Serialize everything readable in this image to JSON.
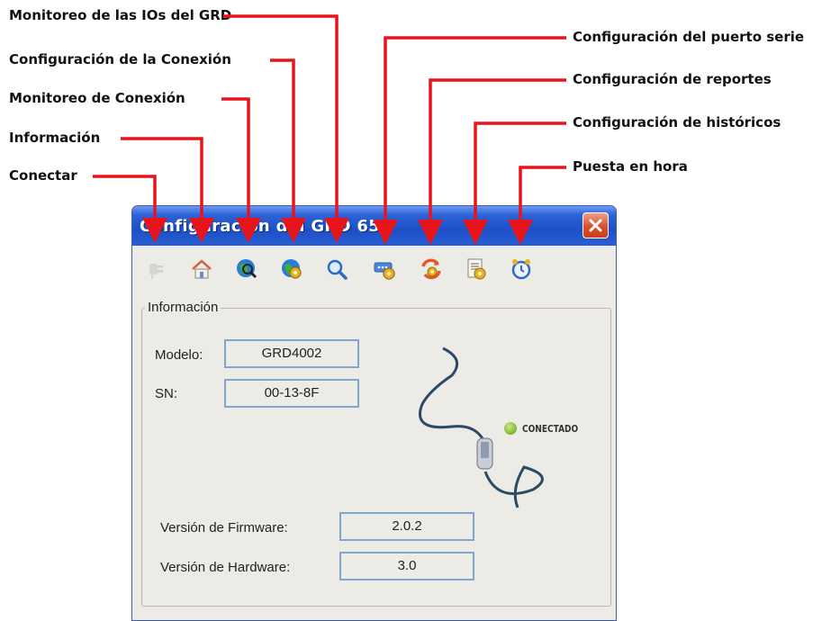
{
  "callouts": {
    "ios_monitor": "Monitoreo de las IOs del GRD",
    "connection_config": "Configuración de la Conexión",
    "connection_monitor": "Monitoreo de Conexión",
    "info": "Información",
    "connect": "Conectar",
    "serial_port_config": "Configuración del puerto serie",
    "reports_config": "Configuración de reportes",
    "history_config": "Configuración de históricos",
    "set_time": "Puesta en hora"
  },
  "window": {
    "title": "Configuración del GRD 654",
    "toolbar_icons": [
      "plug-icon",
      "home-icon",
      "globe-search-icon",
      "globe-gear-icon",
      "magnifier-icon",
      "serial-port-gear-icon",
      "refresh-gear-icon",
      "document-gear-icon",
      "alarm-clock-icon"
    ]
  },
  "info": {
    "legend": "Información",
    "model_label": "Modelo:",
    "model_value": "GRD4002",
    "sn_label": "SN:",
    "sn_value": "00-13-8F",
    "status": "CONECTADO",
    "firmware_label": "Versión de Firmware:",
    "firmware_value": "2.0.2",
    "hardware_label": "Versión de Hardware:",
    "hardware_value": "3.0"
  },
  "colors": {
    "arrow": "#e8141b",
    "titlebar": "#2d63d8",
    "status_dot": "#7bb72e",
    "field_border": "#7fa6d1"
  }
}
